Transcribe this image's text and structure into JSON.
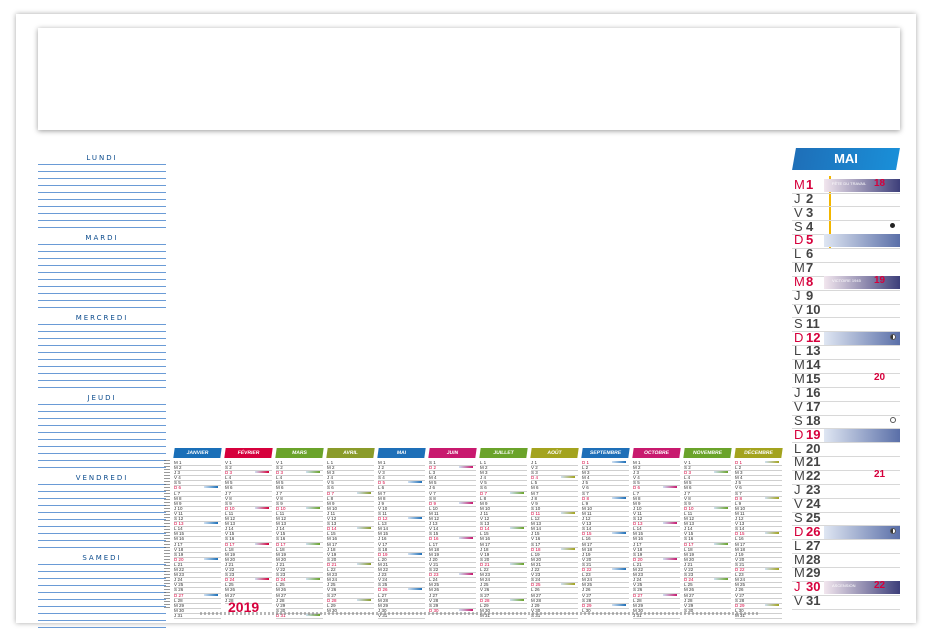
{
  "planner": {
    "days": [
      "LUNDI",
      "MARDI",
      "MERCREDI",
      "JEUDI",
      "VENDREDI",
      "SAMEDI"
    ]
  },
  "year": "2019",
  "months": [
    {
      "name": "JANVIER",
      "color": "#1a6fb8"
    },
    {
      "name": "FÉVRIER",
      "color": "#d6003c"
    },
    {
      "name": "MARS",
      "color": "#6aa32a"
    },
    {
      "name": "AVRIL",
      "color": "#8a9b2a"
    },
    {
      "name": "MAI",
      "color": "#1e6fb8"
    },
    {
      "name": "JUIN",
      "color": "#c8196e"
    },
    {
      "name": "JUILLET",
      "color": "#6aa32a"
    },
    {
      "name": "AOÛT",
      "color": "#a3a31e"
    },
    {
      "name": "SEPTEMBRE",
      "color": "#1e6fb8"
    },
    {
      "name": "OCTOBRE",
      "color": "#c8196e"
    },
    {
      "name": "NOVEMBRE",
      "color": "#6aa32a"
    },
    {
      "name": "DÉCEMBRE",
      "color": "#a3a31e"
    }
  ],
  "may": {
    "title": "MAI",
    "rows": [
      {
        "l": "M",
        "n": "1",
        "type": "hol",
        "fete": "FÊTE DU TRAVAIL",
        "wk": "18"
      },
      {
        "l": "J",
        "n": "2",
        "type": ""
      },
      {
        "l": "V",
        "n": "3",
        "type": ""
      },
      {
        "l": "S",
        "n": "4",
        "type": "",
        "moon": "full"
      },
      {
        "l": "D",
        "n": "5",
        "type": "sun"
      },
      {
        "l": "L",
        "n": "6",
        "type": ""
      },
      {
        "l": "M",
        "n": "7",
        "type": ""
      },
      {
        "l": "M",
        "n": "8",
        "type": "hol",
        "fete": "VICTOIRE 1945",
        "wk": "19"
      },
      {
        "l": "J",
        "n": "9",
        "type": ""
      },
      {
        "l": "V",
        "n": "10",
        "type": ""
      },
      {
        "l": "S",
        "n": "11",
        "type": ""
      },
      {
        "l": "D",
        "n": "12",
        "type": "sun",
        "moon": "half"
      },
      {
        "l": "L",
        "n": "13",
        "type": ""
      },
      {
        "l": "M",
        "n": "14",
        "type": ""
      },
      {
        "l": "M",
        "n": "15",
        "type": "",
        "wk": "20"
      },
      {
        "l": "J",
        "n": "16",
        "type": ""
      },
      {
        "l": "V",
        "n": "17",
        "type": ""
      },
      {
        "l": "S",
        "n": "18",
        "type": "",
        "moon": "empty"
      },
      {
        "l": "D",
        "n": "19",
        "type": "sun"
      },
      {
        "l": "L",
        "n": "20",
        "type": ""
      },
      {
        "l": "M",
        "n": "21",
        "type": ""
      },
      {
        "l": "M",
        "n": "22",
        "type": "",
        "wk": "21"
      },
      {
        "l": "J",
        "n": "23",
        "type": ""
      },
      {
        "l": "V",
        "n": "24",
        "type": ""
      },
      {
        "l": "S",
        "n": "25",
        "type": ""
      },
      {
        "l": "D",
        "n": "26",
        "type": "sun",
        "moon": "half"
      },
      {
        "l": "L",
        "n": "27",
        "type": ""
      },
      {
        "l": "M",
        "n": "28",
        "type": ""
      },
      {
        "l": "M",
        "n": "29",
        "type": ""
      },
      {
        "l": "J",
        "n": "30",
        "type": "hol",
        "fete": "ASCENSION",
        "wk": "22"
      },
      {
        "l": "V",
        "n": "31",
        "type": ""
      }
    ]
  },
  "colors": {
    "accent": "#1e6fb8",
    "holiday": "#d6003c"
  }
}
